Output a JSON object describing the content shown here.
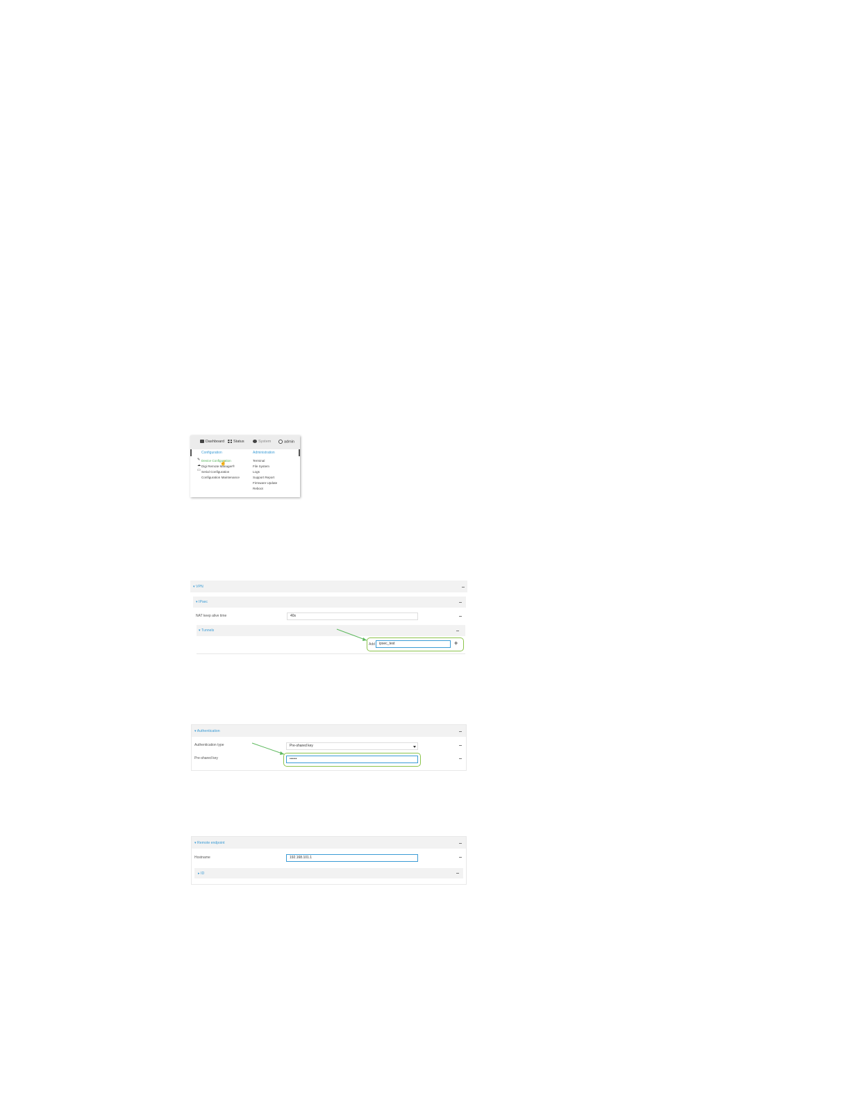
{
  "menu_screenshot": {
    "nav": {
      "dashboard": "Dashboard",
      "status": "Status",
      "system": "System",
      "admin": "admin"
    },
    "configuration_heading": "Configuration",
    "administration_heading": "Administration",
    "configuration_items": [
      "Device Configuration",
      "Digi Remote Manager®",
      "Serial Configuration",
      "Configuration Maintenance"
    ],
    "administration_items": [
      "Terminal",
      "File System",
      "Logs",
      "Support Report",
      "Firmware Update",
      "Reboot"
    ]
  },
  "vpn_screenshot": {
    "vpn_title": "VPN",
    "ipsec_title": "IPsec",
    "nat_keepalive_label": "NAT keep alive time",
    "nat_keepalive_value": "40s",
    "tunnels_title": "Tunnels",
    "add_label": "Add",
    "add_value": "ipsec_test",
    "add_button": "+"
  },
  "auth_screenshot": {
    "title": "Authentication",
    "auth_type_label": "Authentication type",
    "auth_type_value": "Pre-shared key",
    "psk_label": "Pre-shared key",
    "psk_value": "••••••"
  },
  "remote_screenshot": {
    "title": "Remote endpoint",
    "hostname_label": "Hostname",
    "hostname_value": "192.168.101.1",
    "id_title": "ID"
  },
  "colors": {
    "accent_blue": "#3a9bd5",
    "highlight_green": "#8bc34a",
    "panel_header": "#f2f2f2"
  }
}
